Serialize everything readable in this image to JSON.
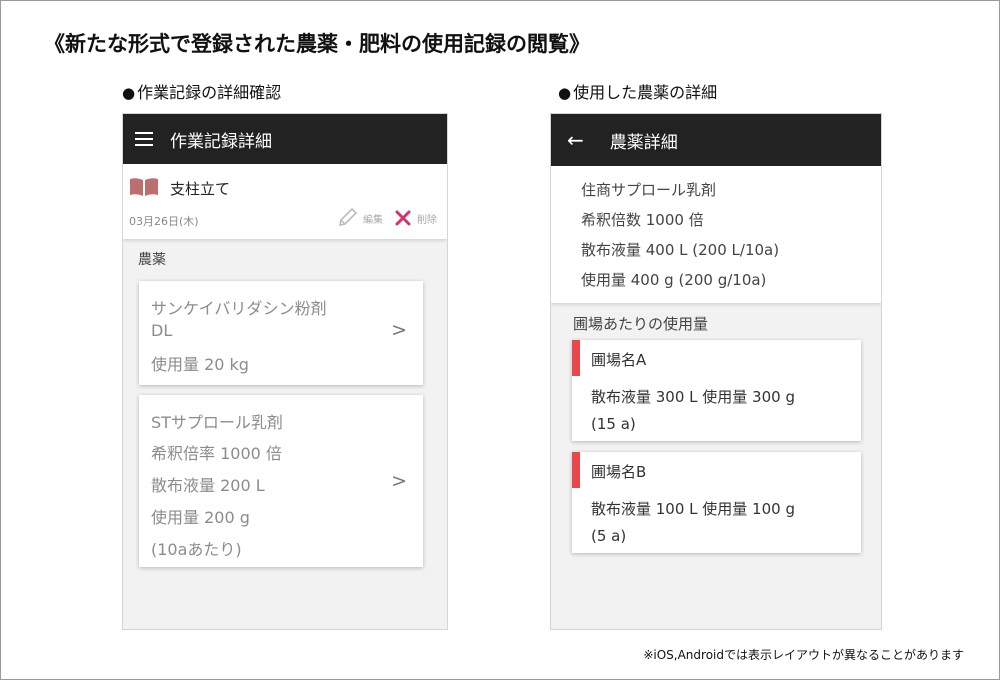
{
  "main_title": "《新たな形式で登録された農薬・肥料の使用記録の閲覧》",
  "left_section": {
    "heading": "作業記録の詳細確認",
    "appbar_title": "作業記録詳細",
    "record": {
      "title": "支柱立て",
      "date": "03月26日(木)",
      "edit_label": "編集",
      "delete_label": "削除"
    },
    "category_label": "農薬",
    "cards": [
      {
        "lines": [
          "サンケイバリダシン粉剤",
          "DL",
          "使用量 20 kg"
        ]
      },
      {
        "lines": [
          "STサプロール乳剤",
          "希釈倍率 1000 倍",
          "散布液量 200 L",
          "使用量 200 g",
          "(10aあたり)"
        ]
      }
    ],
    "chevron": ">"
  },
  "right_section": {
    "heading": "使用した農薬の詳細",
    "appbar_title": "農薬詳細",
    "detail_lines": [
      "住商サプロール乳剤",
      "希釈倍数 1000 倍",
      "散布液量 400 L (200 L/10a)",
      "使用量 400 g (200 g/10a)"
    ],
    "per_field_label": "圃場あたりの使用量",
    "fields": [
      {
        "name": "圃場名A",
        "usage_line1": "散布液量 300 L 使用量 300 g",
        "usage_line2": "(15 a)"
      },
      {
        "name": "圃場名B",
        "usage_line1": "散布液量 100 L 使用量 100 g",
        "usage_line2": "(5 a)"
      }
    ]
  },
  "bullet": "●",
  "footnote": "※iOS,Androidでは表示レイアウトが異なることがあります",
  "colors": {
    "appbar": "#222222",
    "accent_red": "#e8474b",
    "book_icon": "#b9706f",
    "delete_icon": "#d1346a"
  },
  "icons": {
    "menu": "hamburger-icon",
    "back": "arrow-left-icon",
    "book": "book-icon",
    "edit": "pencil-icon",
    "delete": "close-icon"
  }
}
